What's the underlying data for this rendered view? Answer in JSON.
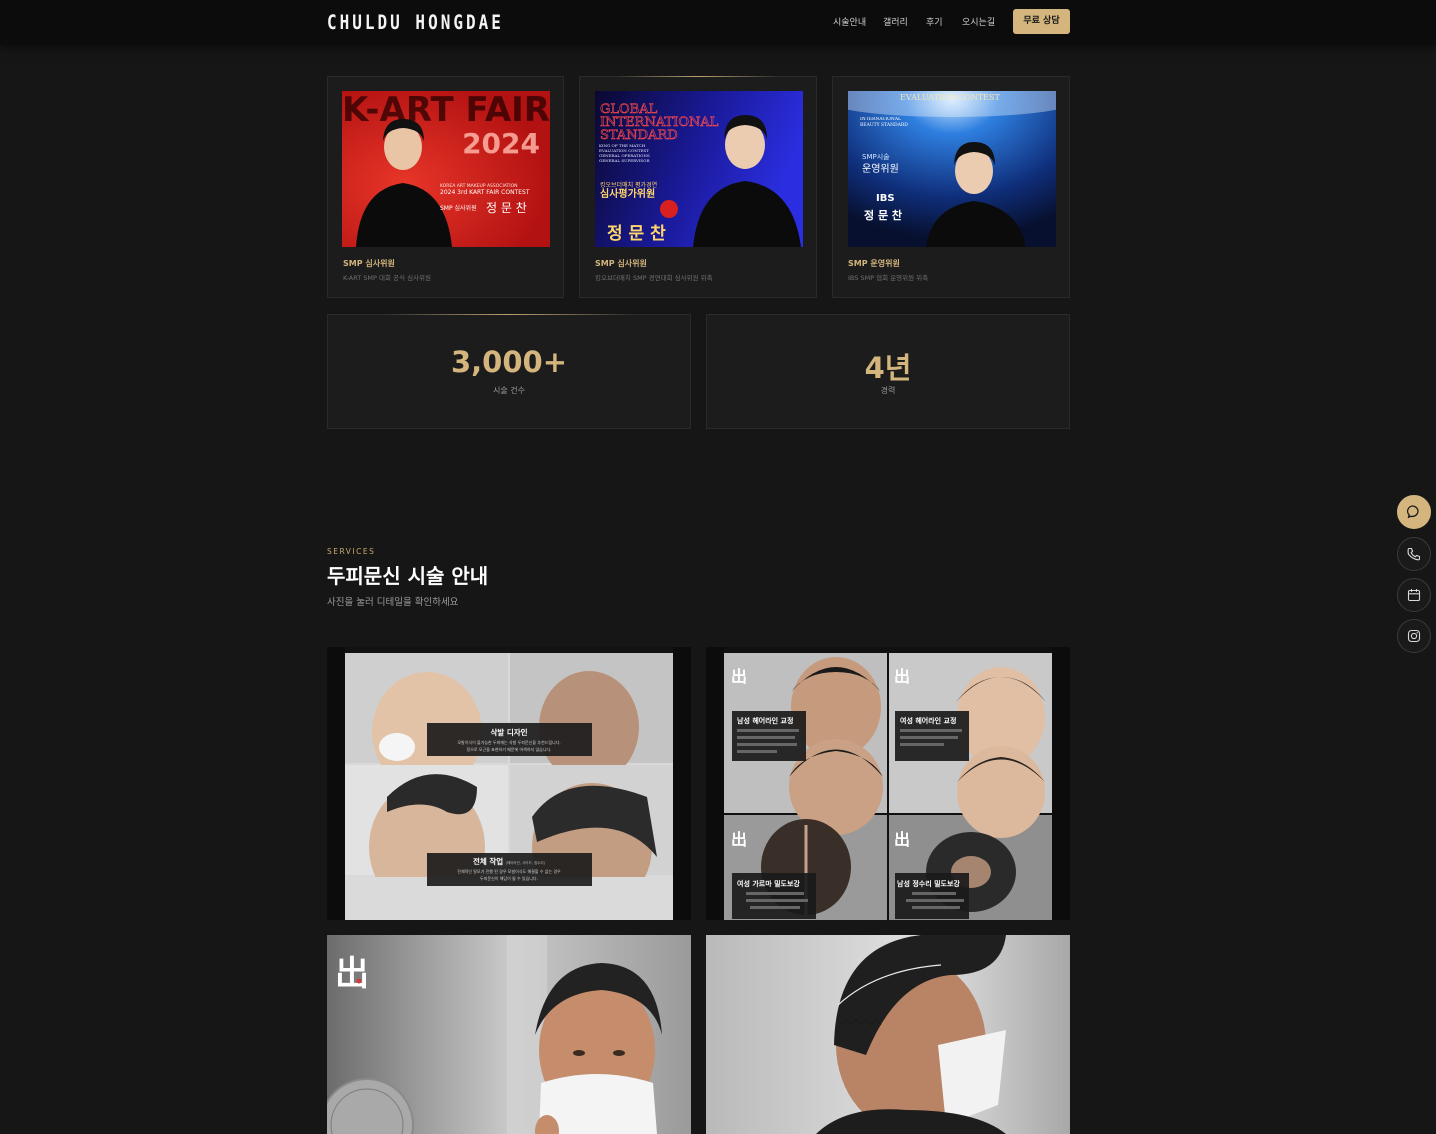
{
  "header": {
    "logo": "CHULDU HONGDAE",
    "nav": [
      "시술안내",
      "갤러리",
      "후기",
      "오시는길"
    ],
    "cta": "무료 상담"
  },
  "awards": [
    {
      "title": "SMP 심사위원",
      "subtitle": "K-ART SMP 대회 공식 심사위원",
      "poster": {
        "headline": "K-ART FAIR",
        "year": "2024",
        "line1": "KOREA ART MAKEUP ASSOCIATION",
        "line2": "2024 3rd KART FAIR CONTEST",
        "role": "SMP 심사위원",
        "name": "정 문 찬"
      }
    },
    {
      "title": "SMP 심사위원",
      "subtitle": "킹오브더매치 SMP 경연대회 심사위원 위촉",
      "poster": {
        "headline1": "GLOBAL",
        "headline2": "INTERNATIONAL",
        "headline3": "STANDARD",
        "small": "KING OF THE MATCH EVALUATION CONTEST GENERAL OPERATIONS GENERAL SUPERVISOR",
        "role_small": "킹오브더매치 평가경연",
        "role": "심사평가위원",
        "name": "정 문 찬"
      }
    },
    {
      "title": "SMP 운영위원",
      "subtitle": "IBS SMP 협회 운영위원 위촉",
      "poster": {
        "headline": "EVALUATION CONTEST",
        "badge": "INTERNATIONAL BEAUTY STANDARD",
        "role_small": "SMP시술",
        "role": "운영위원",
        "org": "IBS",
        "name": "정 문 찬"
      }
    }
  ],
  "stats": [
    {
      "value": "3,000+",
      "label": "시술 건수"
    },
    {
      "value": "4년",
      "label": "경력"
    }
  ],
  "services": {
    "eyebrow": "SERVICES",
    "title": "두피문신 시술 안내",
    "subtitle": "사진을 눌러 디테일을 확인하세요"
  },
  "gallery": {
    "item1": {
      "box1_title": "삭발 디자인",
      "box1_text1": "모발이식이 불가능한 두피에는 삭발 두피문신을 추천드립니다.",
      "box1_text2": "정으로 모근을 표현하기 때문에 어색하지 않습니다.",
      "box2_title": "전체 작업",
      "box2_small": "(헤어라인, 사이드, 정수리)",
      "box2_text1": "전체적인 탈모가 진행 된 경우 모발이식도 해결할 수 없는 경우",
      "box2_text2": "두피문신이 해답이 될 수 있습니다."
    },
    "item2": {
      "t1": "남성 헤어라인 교정",
      "t2": "여성 헤어라인 교정",
      "t3": "여성 가르마 밀도보강",
      "t4": "남성 정수리 밀도보강",
      "logo": "出"
    },
    "item3": {
      "logo": "出"
    }
  },
  "floating": [
    "chat-icon",
    "phone-icon",
    "calendar-icon",
    "instagram-icon"
  ],
  "colors": {
    "accent": "#d3b57d",
    "background": "#161616",
    "card": "#1c1c1c"
  }
}
